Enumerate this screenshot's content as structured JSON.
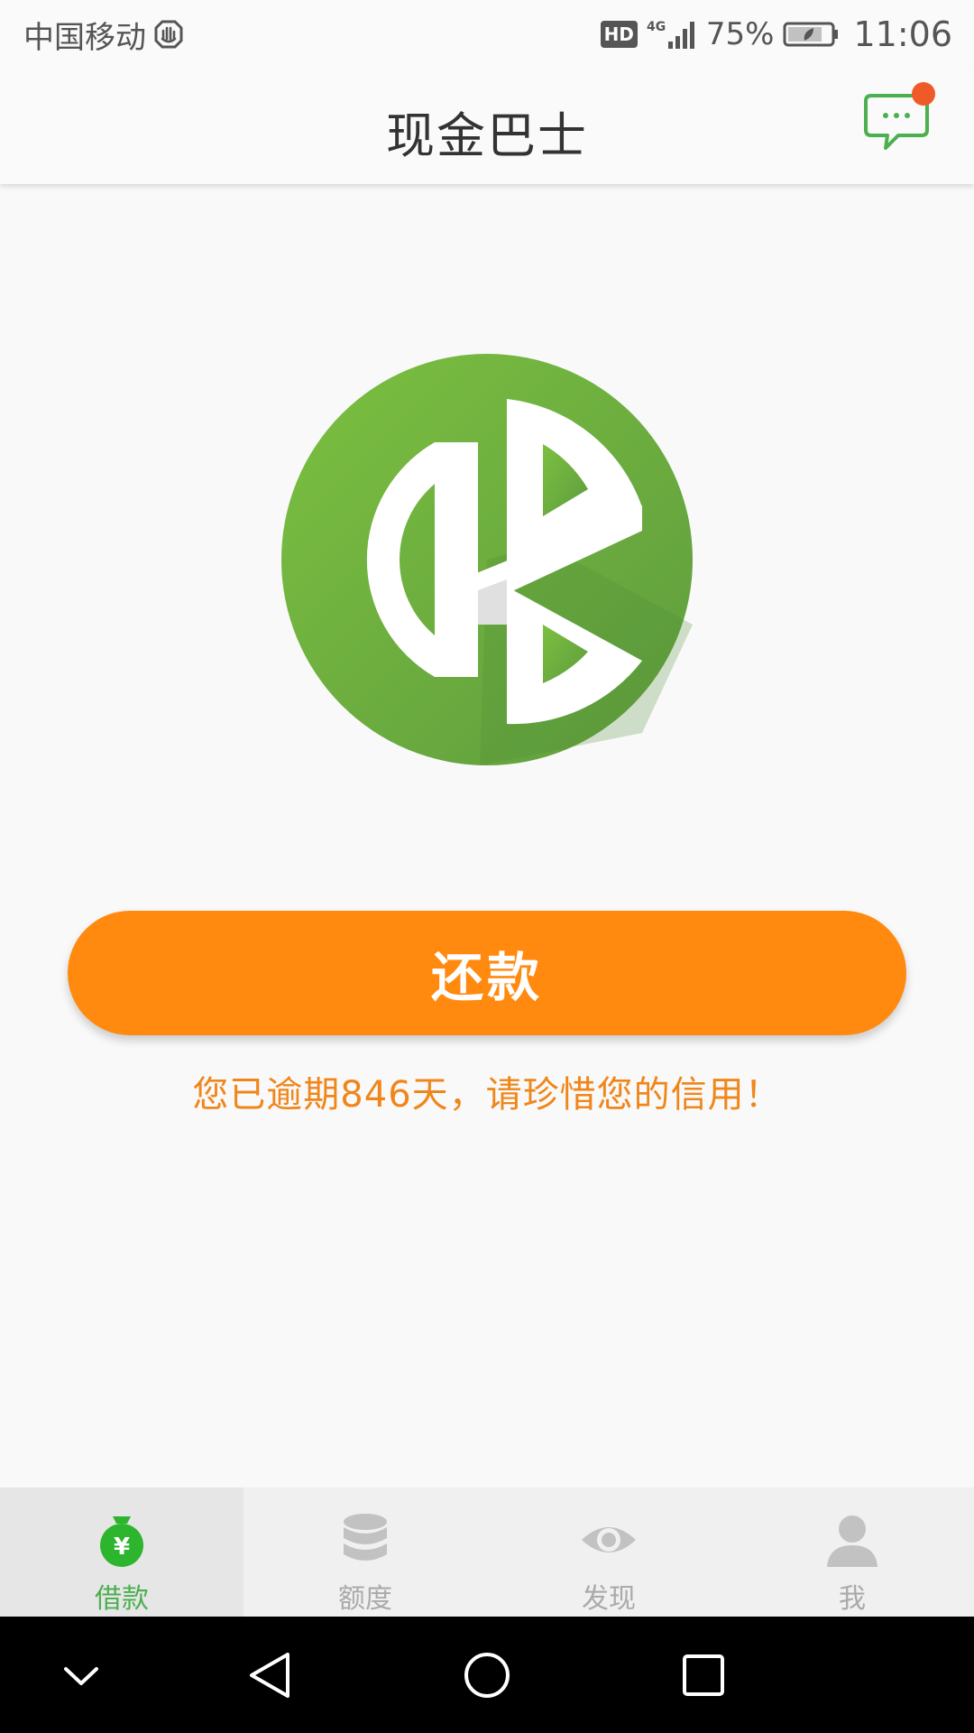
{
  "status_bar": {
    "carrier": "中国移动",
    "hd_badge": "HD",
    "network": "4G",
    "battery": "75%",
    "time": "11:06"
  },
  "header": {
    "title": "现金巴士",
    "has_notification": true
  },
  "logo": {
    "icon": "cash-bus-logo",
    "brand_color": "#6db33f"
  },
  "main": {
    "repay_button_label": "还款",
    "overdue_notice": "您已逾期846天，请珍惜您的信用！"
  },
  "tabs": [
    {
      "label": "借款",
      "icon": "money-bag-icon",
      "active": true
    },
    {
      "label": "额度",
      "icon": "database-icon",
      "active": false
    },
    {
      "label": "发现",
      "icon": "eye-icon",
      "active": false
    },
    {
      "label": "我",
      "icon": "person-icon",
      "active": false
    }
  ],
  "colors": {
    "accent": "#ff8a0f",
    "notice": "#f0861a",
    "active_tab": "#4caf50",
    "inactive_tab": "#aaaaaa",
    "badge": "#f05a28"
  }
}
